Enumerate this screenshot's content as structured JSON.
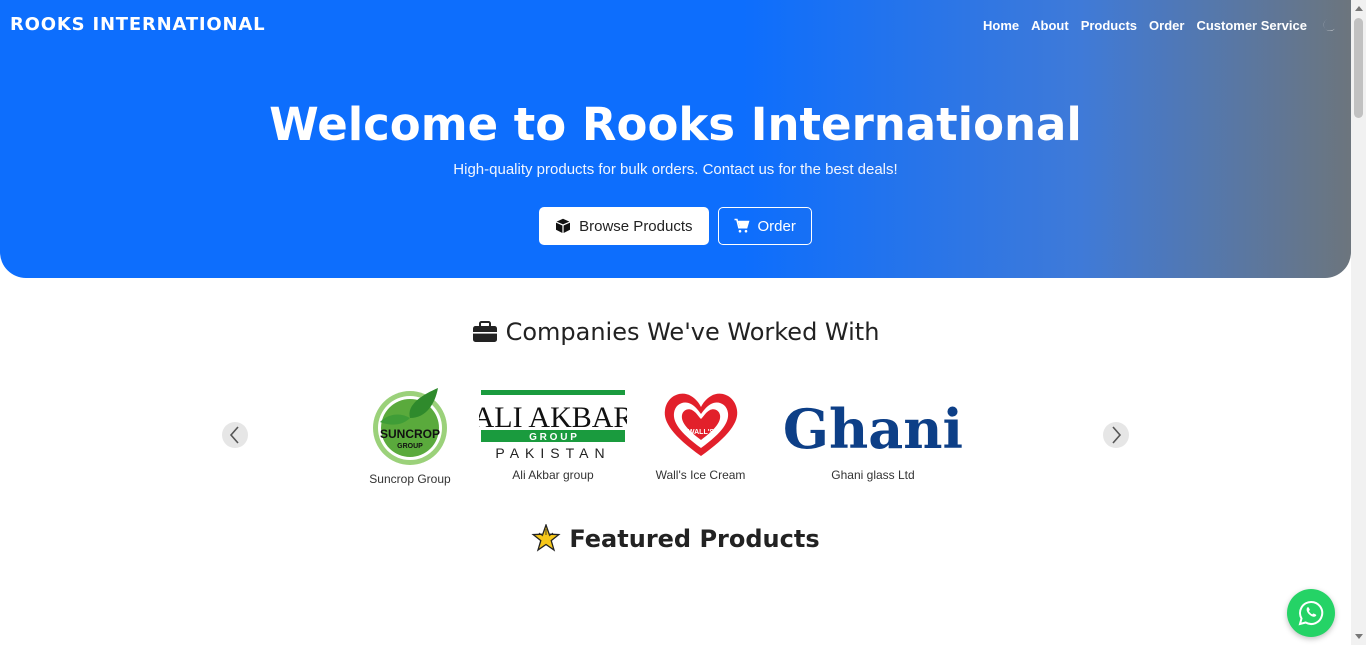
{
  "nav": {
    "brand": "ROOKS INTERNATIONAL",
    "links": [
      "Home",
      "About",
      "Products",
      "Order",
      "Customer Service"
    ],
    "theme_icon": "moon-icon"
  },
  "hero": {
    "title": "Welcome to Rooks International",
    "subtitle": "High-quality products for bulk orders. Contact us for the best deals!",
    "browse_label": "Browse Products",
    "order_label": "Order"
  },
  "companies": {
    "title": "Companies We've Worked With",
    "items": [
      {
        "name": "Suncrop Group",
        "logo_text": "SUNCROP",
        "logo_sub": "GROUP"
      },
      {
        "name": "Ali Akbar group",
        "logo_text": "ALI AKBAR",
        "logo_sub": "G R O U P",
        "logo_sub2": "PAKISTAN"
      },
      {
        "name": "Wall's Ice Cream",
        "logo_text": "WALL'S"
      },
      {
        "name": "Ghani glass Ltd",
        "logo_text": "Ghani"
      }
    ]
  },
  "featured": {
    "title": "Featured Products"
  },
  "colors": {
    "primary": "#0d6efd",
    "gradient_end": "#6c757d",
    "whatsapp": "#25d366"
  }
}
